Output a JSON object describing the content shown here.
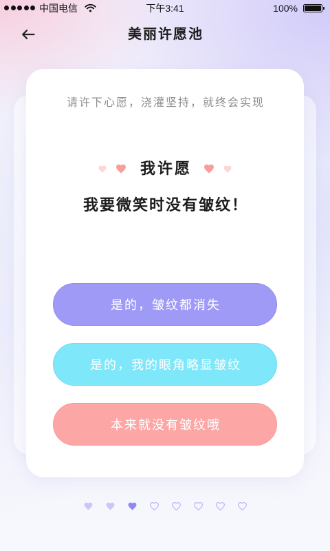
{
  "status_bar": {
    "signal_icon": "signal-dots-icon",
    "signal_strength": 5,
    "carrier": "中国电信",
    "wifi_icon": "wifi-icon",
    "time": "下午3:41",
    "battery_text": "100%",
    "battery_icon": "battery-icon",
    "battery_level": 1.0
  },
  "nav": {
    "back_icon": "back-arrow-icon",
    "title": "美丽许愿池"
  },
  "wish_card": {
    "subtitle": "请许下心愿，浇灌坚持，就终会实现",
    "heading": "我许愿",
    "heading_icon": "heart-icon",
    "heart_colors": {
      "light": "#fdd6d6",
      "strong": "#fb9c9c"
    },
    "wish_text": "我要微笑时没有皱纹！",
    "options": [
      {
        "label": "是的，皱纹都消失",
        "color": "#a09af7"
      },
      {
        "label": "是的，我的眼角略显皱纹",
        "color": "#7ee7fa"
      },
      {
        "label": "本来就没有皱纹哦",
        "color": "#fca6a5"
      }
    ]
  },
  "pager": {
    "icon": "heart-icon",
    "total": 8,
    "current": 3,
    "filled_color": "#cac6fa",
    "current_color": "#8f88f3",
    "outline_color": "#bdb9f6"
  }
}
